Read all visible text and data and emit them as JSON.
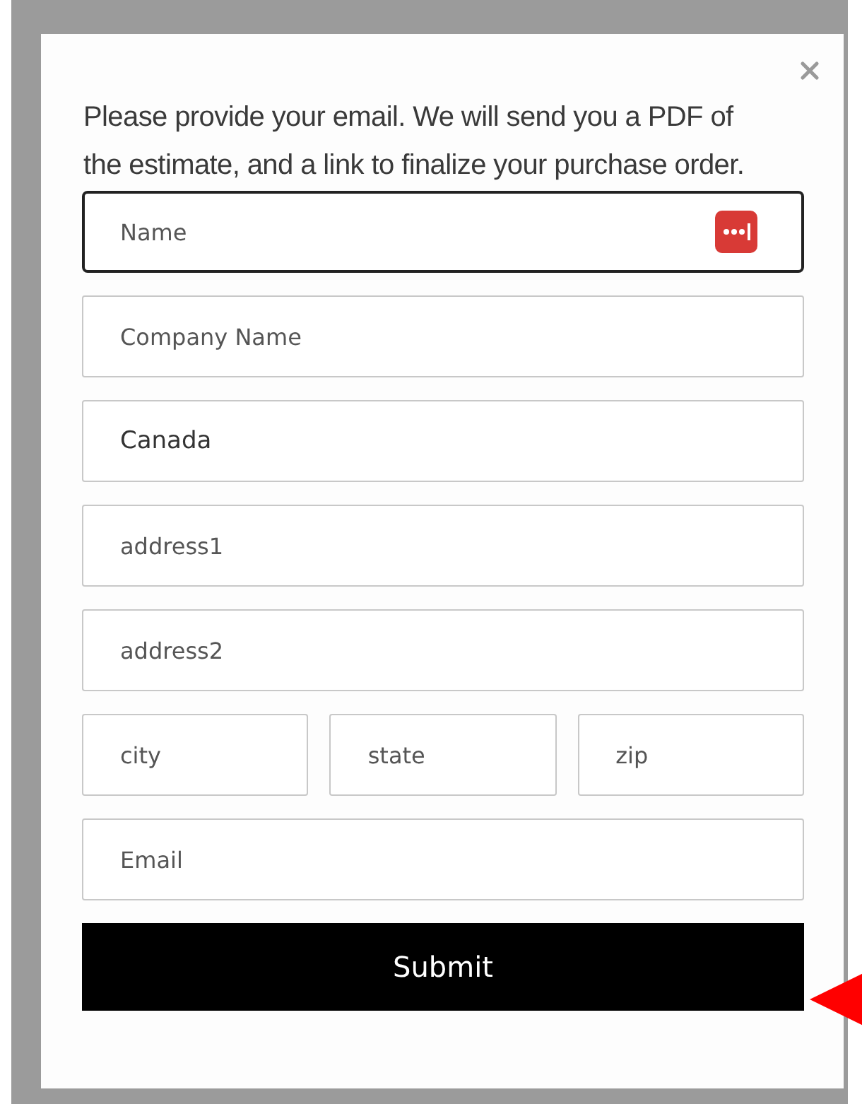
{
  "dialog": {
    "message": "Please provide your email. We will send you a PDF of the estimate, and a link to finalize your purchase order.",
    "rows": [
      [
        {
          "placeholder": "Name",
          "focused": true,
          "autofill_icon": true
        }
      ],
      [
        {
          "placeholder": "Company Name",
          "focused": false,
          "autofill_icon": false
        }
      ],
      [
        {
          "value": "Canada",
          "focused": false,
          "autofill_icon": false
        }
      ],
      [
        {
          "placeholder": "address1",
          "focused": false,
          "autofill_icon": false
        }
      ],
      [
        {
          "placeholder": "address2",
          "focused": false,
          "autofill_icon": false
        }
      ],
      [
        {
          "placeholder": "city",
          "focused": false,
          "autofill_icon": false
        },
        {
          "placeholder": "state",
          "focused": false,
          "autofill_icon": false
        },
        {
          "placeholder": "zip",
          "focused": false,
          "autofill_icon": false
        }
      ],
      [
        {
          "placeholder": "Email",
          "focused": false,
          "autofill_icon": false
        }
      ]
    ],
    "submit": "Submit"
  }
}
